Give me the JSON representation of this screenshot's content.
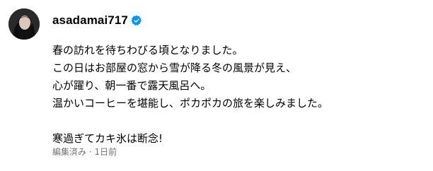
{
  "post": {
    "username": "asadamai717",
    "verified_icon": "verified-badge-icon",
    "avatar_icon": "profile-avatar",
    "colors": {
      "text": "#000000",
      "secondary_text": "#737373",
      "verified_blue": "#0095f6"
    },
    "caption_lines": [
      "春の訪れを待ちわびる頃となりました。",
      "この日はお部屋の窓から雪が降る冬の風景が見え、",
      "心が躍り、朝一番で露天風呂へ。",
      "温かいコーヒーを堪能し、ポカポカの旅を楽しみました。",
      "",
      "寒過ぎてカキ氷は断念!"
    ],
    "meta": {
      "edited": "編集済み",
      "separator": " · ",
      "time": "1日前"
    }
  }
}
